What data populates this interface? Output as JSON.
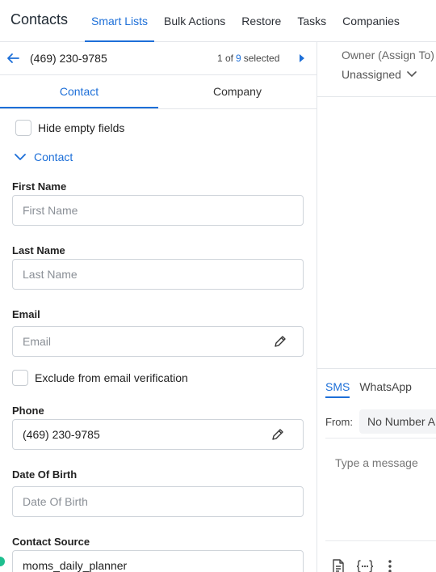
{
  "header": {
    "title": "Contacts",
    "nav": [
      {
        "label": "Smart Lists",
        "active": true
      },
      {
        "label": "Bulk Actions",
        "active": false
      },
      {
        "label": "Restore",
        "active": false
      },
      {
        "label": "Tasks",
        "active": false
      },
      {
        "label": "Companies",
        "active": false
      }
    ]
  },
  "record_nav": {
    "phone": "(469) 230-9785",
    "pager_prefix": "1 of",
    "pager_total": "9",
    "pager_suffix": "selected"
  },
  "tabs": [
    {
      "label": "Contact",
      "active": true
    },
    {
      "label": "Company",
      "active": false
    }
  ],
  "hide_empty_label": "Hide empty fields",
  "section_title": "Contact",
  "fields": {
    "first_name": {
      "label": "First Name",
      "placeholder": "First Name",
      "value": ""
    },
    "last_name": {
      "label": "Last Name",
      "placeholder": "Last Name",
      "value": ""
    },
    "email": {
      "label": "Email",
      "placeholder": "Email",
      "value": ""
    },
    "exclude_label": "Exclude from email verification",
    "phone": {
      "label": "Phone",
      "value": "(469) 230-9785"
    },
    "dob": {
      "label": "Date Of Birth",
      "placeholder": "Date Of Birth",
      "value": ""
    },
    "source": {
      "label": "Contact Source",
      "value": "moms_daily_planner"
    }
  },
  "owner": {
    "label": "Owner (Assign To)",
    "value": "Unassigned"
  },
  "composer": {
    "tabs": [
      {
        "label": "SMS",
        "active": true
      },
      {
        "label": "WhatsApp",
        "active": false
      }
    ],
    "from_label": "From:",
    "from_value": "No Number A",
    "message_placeholder": "Type a message"
  },
  "colors": {
    "accent": "#1d6fd8",
    "status_dot": "#1fbf8f"
  },
  "icons": [
    "back-arrow-icon",
    "next-arrow-icon",
    "chevron-down-icon",
    "pencil-icon",
    "document-icon",
    "custom-values-icon",
    "more-vertical-icon"
  ]
}
